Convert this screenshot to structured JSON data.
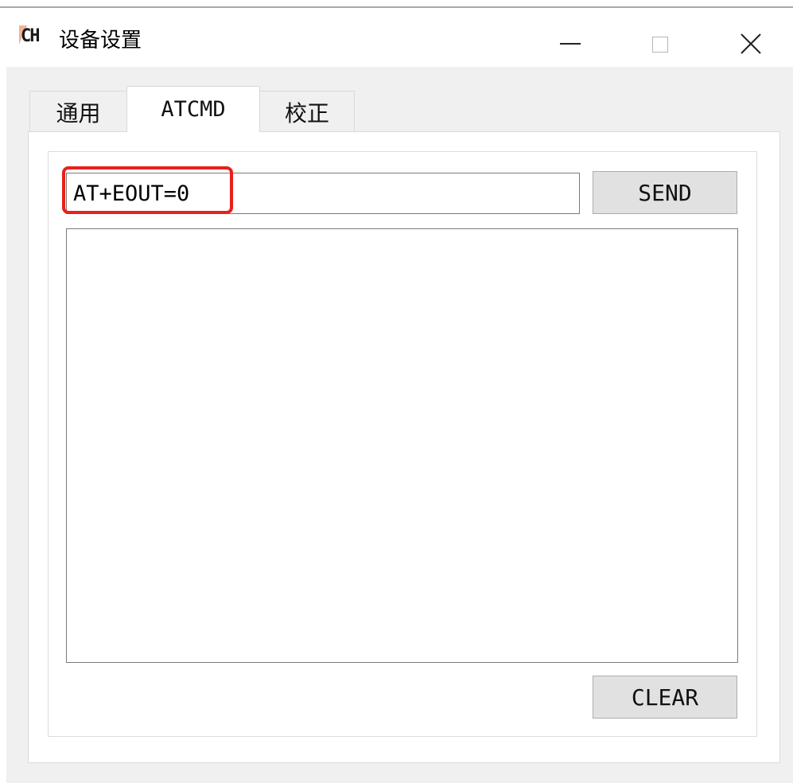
{
  "window": {
    "title": "设备设置",
    "icon_text": "CH",
    "icon": "app-icon",
    "controls": [
      "minimize-icon",
      "maximize-icon",
      "close-icon"
    ]
  },
  "tabs": [
    {
      "label": "通用",
      "selected": false
    },
    {
      "label": "ATCMD",
      "selected": true
    },
    {
      "label": "校正",
      "selected": false
    }
  ],
  "atcmd": {
    "command_value": "AT+EOUT=0",
    "send_label": "SEND",
    "clear_label": "CLEAR",
    "output_text": ""
  },
  "colors": {
    "highlight": "#e8201a",
    "button_bg": "#e1e1e1",
    "client_bg": "#f0f0f0"
  }
}
